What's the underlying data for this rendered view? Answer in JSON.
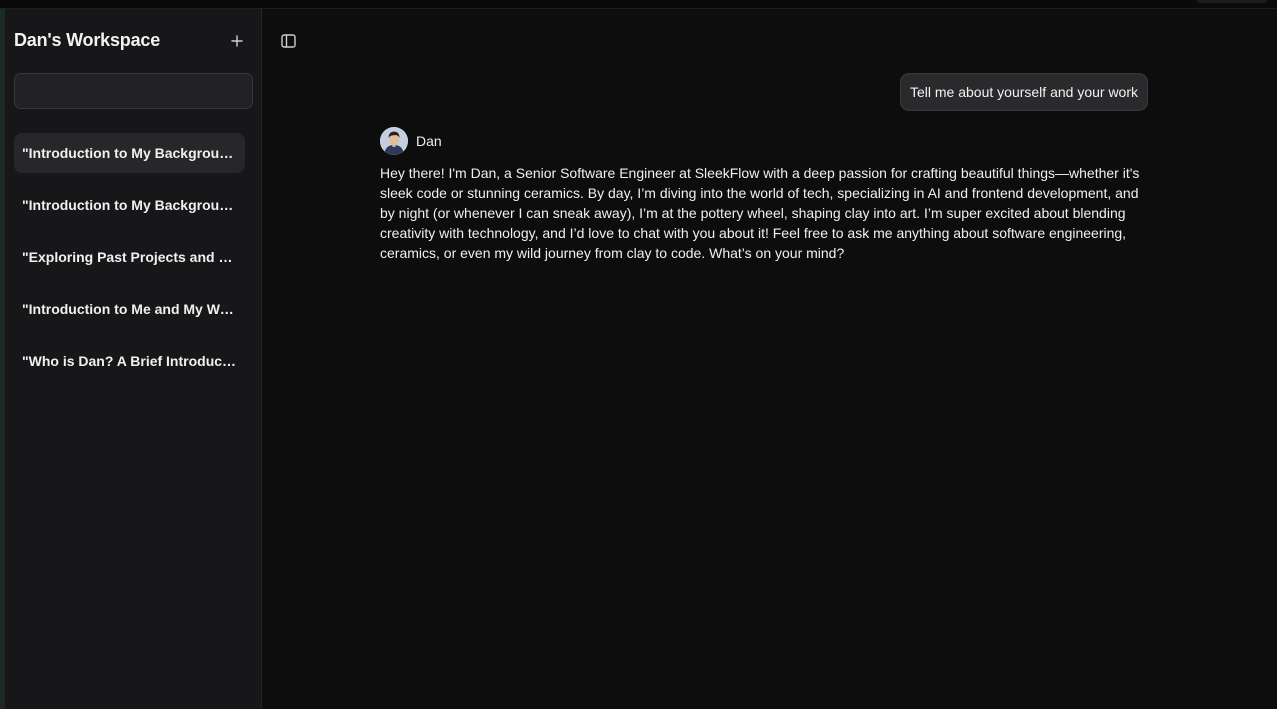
{
  "sidebar": {
    "workspace_title": "Dan's Workspace",
    "new_chat_icon": "plus-icon",
    "search": {
      "value": "",
      "placeholder": ""
    },
    "conversations": [
      {
        "title": "\"Introduction to My Background and Work\"",
        "active": true
      },
      {
        "title": "\"Introduction to My Background and Experience\"",
        "active": false
      },
      {
        "title": "\"Exploring Past Projects and Experiences\"",
        "active": false
      },
      {
        "title": "\"Introduction to Me and My Work\"",
        "active": false
      },
      {
        "title": "\"Who is Dan? A Brief Introduction\"",
        "active": false
      }
    ]
  },
  "main": {
    "toggle_icon": "sidebar-toggle-icon",
    "user_message": "Tell me about yourself and your work",
    "assistant": {
      "name": "Dan",
      "avatar_icon": "avatar",
      "reply": "Hey there! I'm Dan, a Senior Software Engineer at SleekFlow with a deep passion for crafting beautiful things—whether it's sleek code or stunning ceramics. By day, I’m diving into the world of tech, specializing in AI and frontend development, and by night (or whenever I can sneak away), I’m at the pottery wheel, shaping clay into art. I’m super excited about blending creativity with technology, and I’d love to chat with you about it! Feel free to ask me anything about software engineering, ceramics, or even my wild journey from clay to code. What’s on your mind?"
    }
  },
  "colors": {
    "background": "#0d0d0e",
    "sidebar": "#17171a",
    "active_item": "#27272a",
    "bubble": "#2a2a2d",
    "text": "#f0f0f0"
  }
}
